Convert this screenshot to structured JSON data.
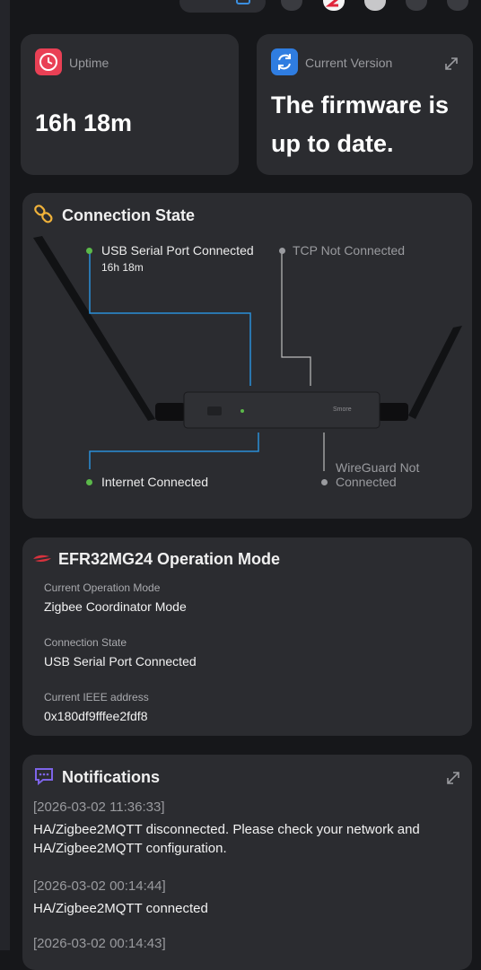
{
  "uptime_card": {
    "label": "Uptime",
    "value": "16h 18m"
  },
  "version_card": {
    "label": "Current Version",
    "message_line1": "The firmware is",
    "message_line2": "up to date."
  },
  "connection_card": {
    "title": "Connection State",
    "usb_label": "USB Serial Port Connected",
    "usb_uptime": "16h 18m",
    "tcp_label": "TCP Not Connected",
    "internet_label": "Internet Connected",
    "wireguard_line1": "WireGuard Not",
    "wireguard_line2": "Connected",
    "device_brand": "Smore",
    "colors": {
      "connected": "#5bb94a",
      "disconnected": "#9a9b9f",
      "line_active": "#2a8fd8",
      "line_inactive": "#bdbdbd"
    }
  },
  "operation_card": {
    "title": "EFR32MG24 Operation Mode",
    "fields": [
      {
        "label": "Current Operation Mode",
        "value": "Zigbee Coordinator Mode"
      },
      {
        "label": "Connection State",
        "value": "USB Serial Port Connected"
      },
      {
        "label": "Current IEEE address",
        "value": "0x180df9fffee2fdf8"
      }
    ]
  },
  "notifications_card": {
    "title": "Notifications",
    "items": [
      {
        "timestamp": "[2026-03-02 11:36:33]",
        "message": "HA/Zigbee2MQTT disconnected. Please check your network and HA/Zigbee2MQTT configuration."
      },
      {
        "timestamp": "[2026-03-02 00:14:44]",
        "message": "HA/Zigbee2MQTT connected"
      },
      {
        "timestamp": "[2026-03-02 00:14:43]",
        "message": ""
      }
    ]
  },
  "icons": {
    "uptime": "clock-icon",
    "version": "refresh-icon",
    "connection": "link-icon",
    "operation": "silabs-logo-icon",
    "notifications": "chat-icon",
    "expand": "expand-icon"
  }
}
